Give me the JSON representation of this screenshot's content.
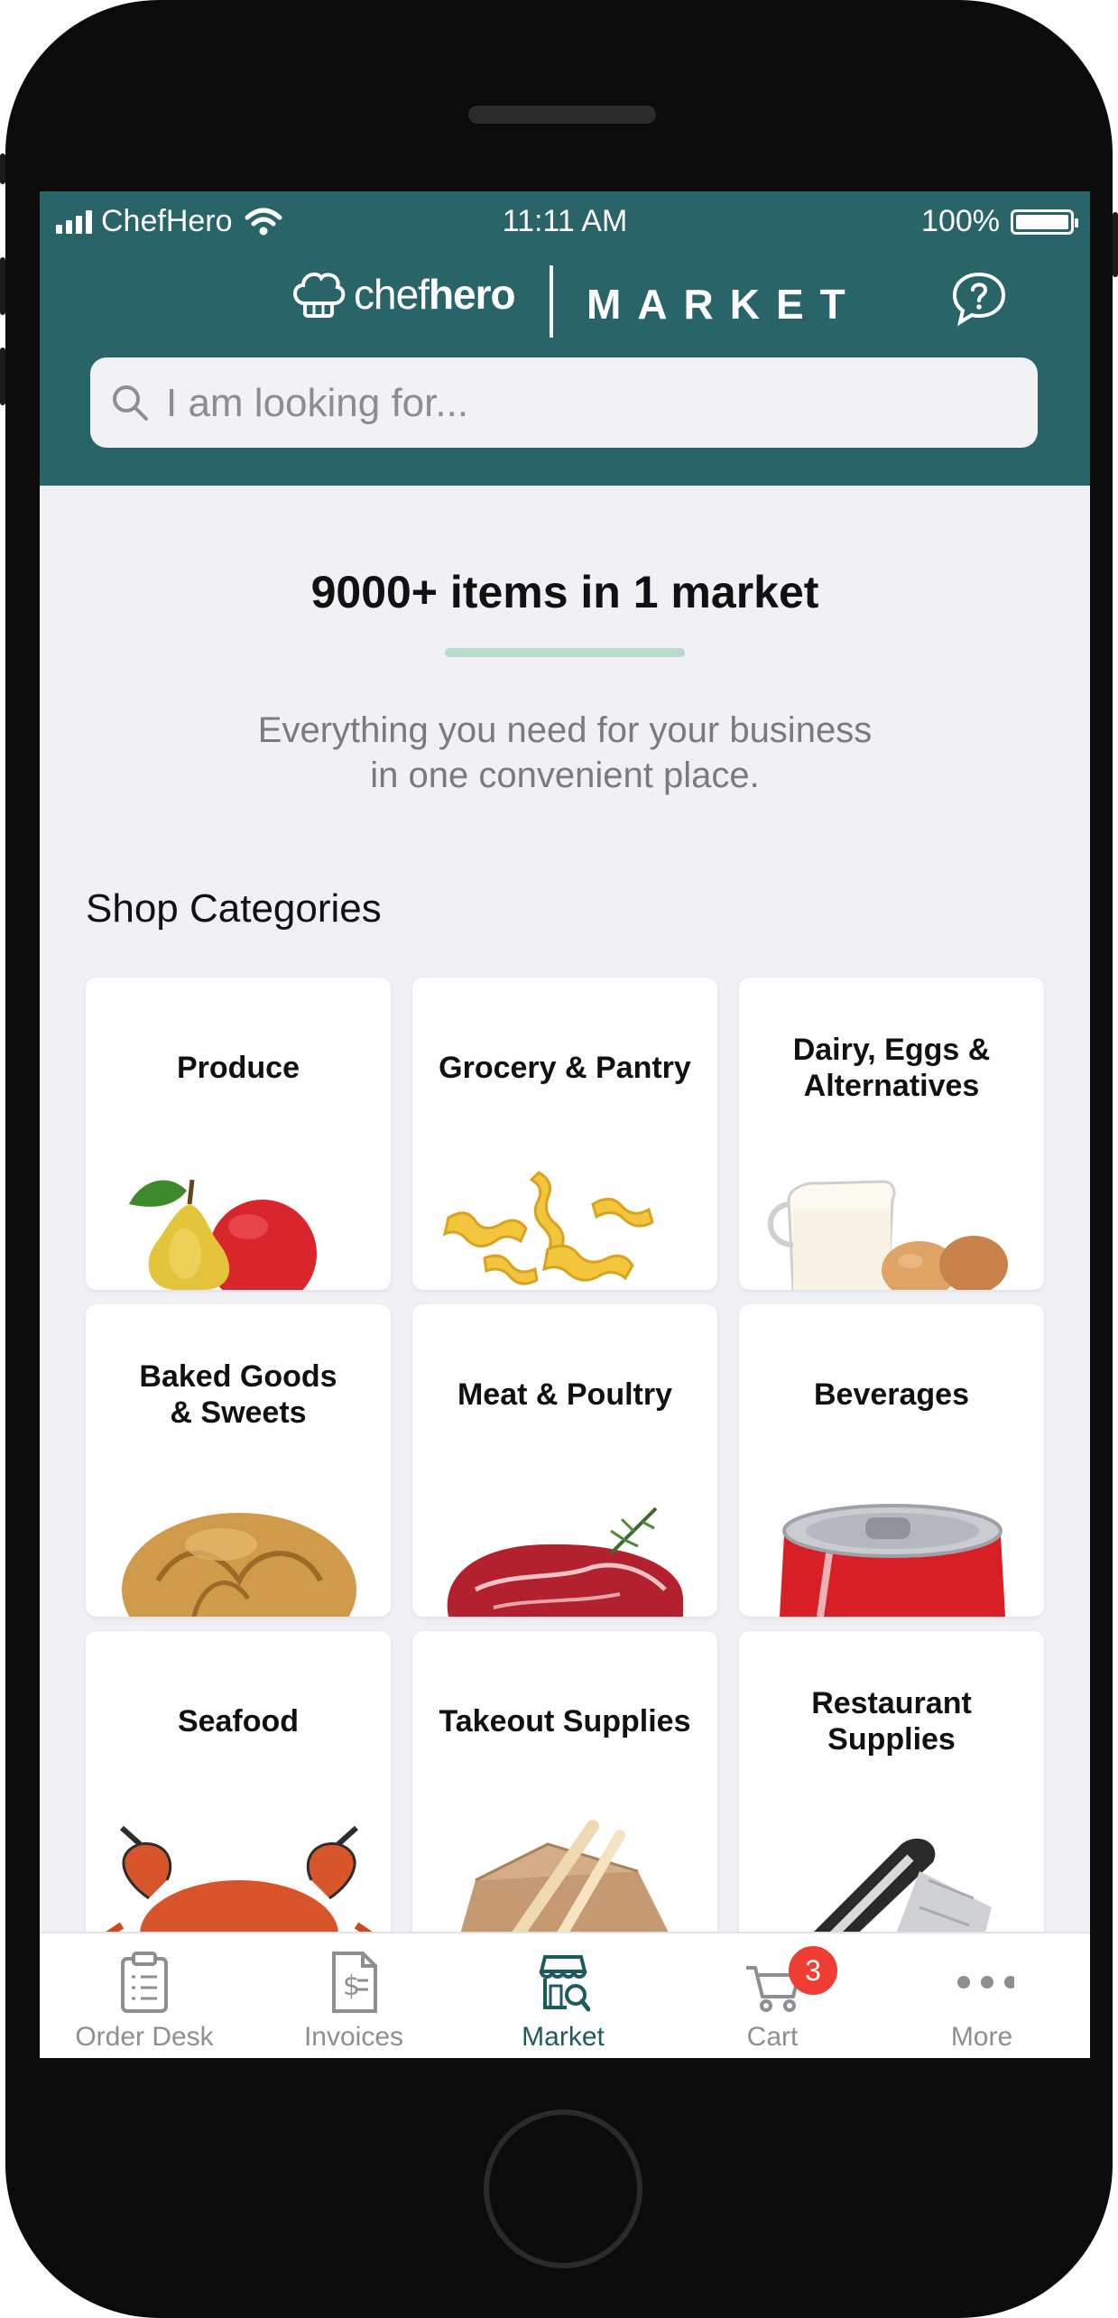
{
  "status_bar": {
    "carrier": "ChefHero",
    "time": "11:11 AM",
    "battery": "100%",
    "signal_icon": "cellular-signal-icon",
    "wifi_icon": "wifi-icon",
    "battery_icon": "battery-full-icon"
  },
  "header": {
    "brand_left": "chef",
    "brand_bold": "hero",
    "brand_market": "MARKET",
    "help_icon": "question-chat-icon",
    "background_color": "#296468"
  },
  "search": {
    "placeholder": "I am looking for..."
  },
  "hero": {
    "title": "9000+ items in 1 market",
    "subtitle_line1": "Everything you need for your business",
    "subtitle_line2": "in one convenient place.",
    "underline_color": "#b7dccc"
  },
  "categories": {
    "title": "Shop Categories",
    "items": [
      {
        "line1": "Produce",
        "line2": "",
        "image": "pear-and-apple"
      },
      {
        "line1": "Grocery & Pantry",
        "line2": "",
        "image": "fusilli-pasta"
      },
      {
        "line1": "Dairy, Eggs &",
        "line2": "Alternatives",
        "image": "milk-jug-and-eggs"
      },
      {
        "line1": "Baked Goods",
        "line2": "& Sweets",
        "image": "bread-roll"
      },
      {
        "line1": "Meat & Poultry",
        "line2": "",
        "image": "raw-steak"
      },
      {
        "line1": "Beverages",
        "line2": "",
        "image": "soda-can"
      },
      {
        "line1": "Seafood",
        "line2": "",
        "image": "crab"
      },
      {
        "line1": "Takeout Supplies",
        "line2": "",
        "image": "takeout-box-and-fork"
      },
      {
        "line1": "Restaurant",
        "line2": "Supplies",
        "image": "aluminum-foil-roll"
      }
    ]
  },
  "tabbar": {
    "items": [
      {
        "label": "Order Desk",
        "icon": "clipboard-icon",
        "active": false
      },
      {
        "label": "Invoices",
        "icon": "invoice-icon",
        "active": false
      },
      {
        "label": "Market",
        "icon": "storefront-search-icon",
        "active": true
      },
      {
        "label": "Cart",
        "icon": "cart-icon",
        "active": false,
        "badge": "3"
      },
      {
        "label": "More",
        "icon": "more-dots-icon",
        "active": false
      }
    ],
    "active_color": "#1e5a5e",
    "badge_color": "#ef3d33"
  }
}
